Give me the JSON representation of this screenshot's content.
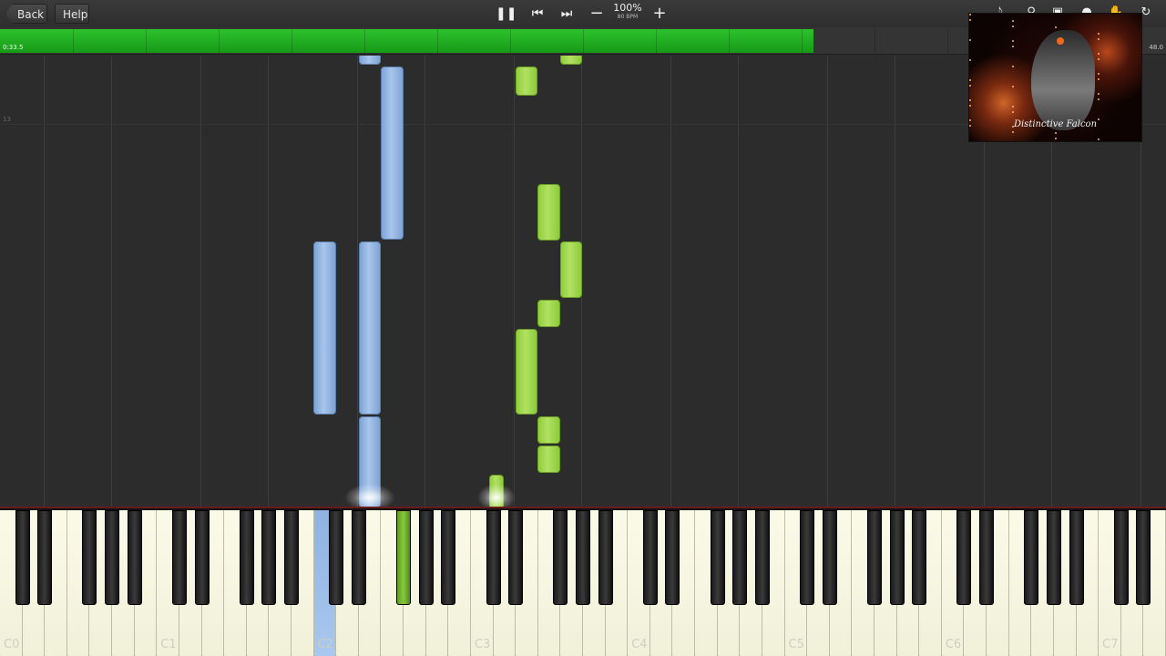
{
  "toolbar": {
    "back_label": "Back",
    "help_label": "Help",
    "speed_percent": "100%",
    "tempo": "80 BPM",
    "icons": [
      "pause-icon",
      "skip-back-icon",
      "skip-forward-icon",
      "minus-icon",
      "plus-icon",
      "metronome-icon",
      "search-icon",
      "camera-icon",
      "user-icon",
      "hand-icon",
      "loop-icon"
    ]
  },
  "progress": {
    "time_elapsed": "0:33.5",
    "time_end": "48.0",
    "fraction": 0.698
  },
  "roll": {
    "measure_number": "13"
  },
  "keyboard": {
    "octave_labels": [
      "C0",
      "C1",
      "C2",
      "C3",
      "C4",
      "C5",
      "C6",
      "C7"
    ],
    "pressed": [
      {
        "key": "C2",
        "hand": "left",
        "color": "#8fb2e0"
      },
      {
        "key": "F#2",
        "hand": "right",
        "color": "#86c93a"
      }
    ]
  },
  "thumbnail": {
    "caption": "Distinctive Falcon"
  },
  "colors": {
    "left_hand": "#a8c6ec",
    "right_hand": "#b2e063",
    "progress": "#2cc22c"
  }
}
